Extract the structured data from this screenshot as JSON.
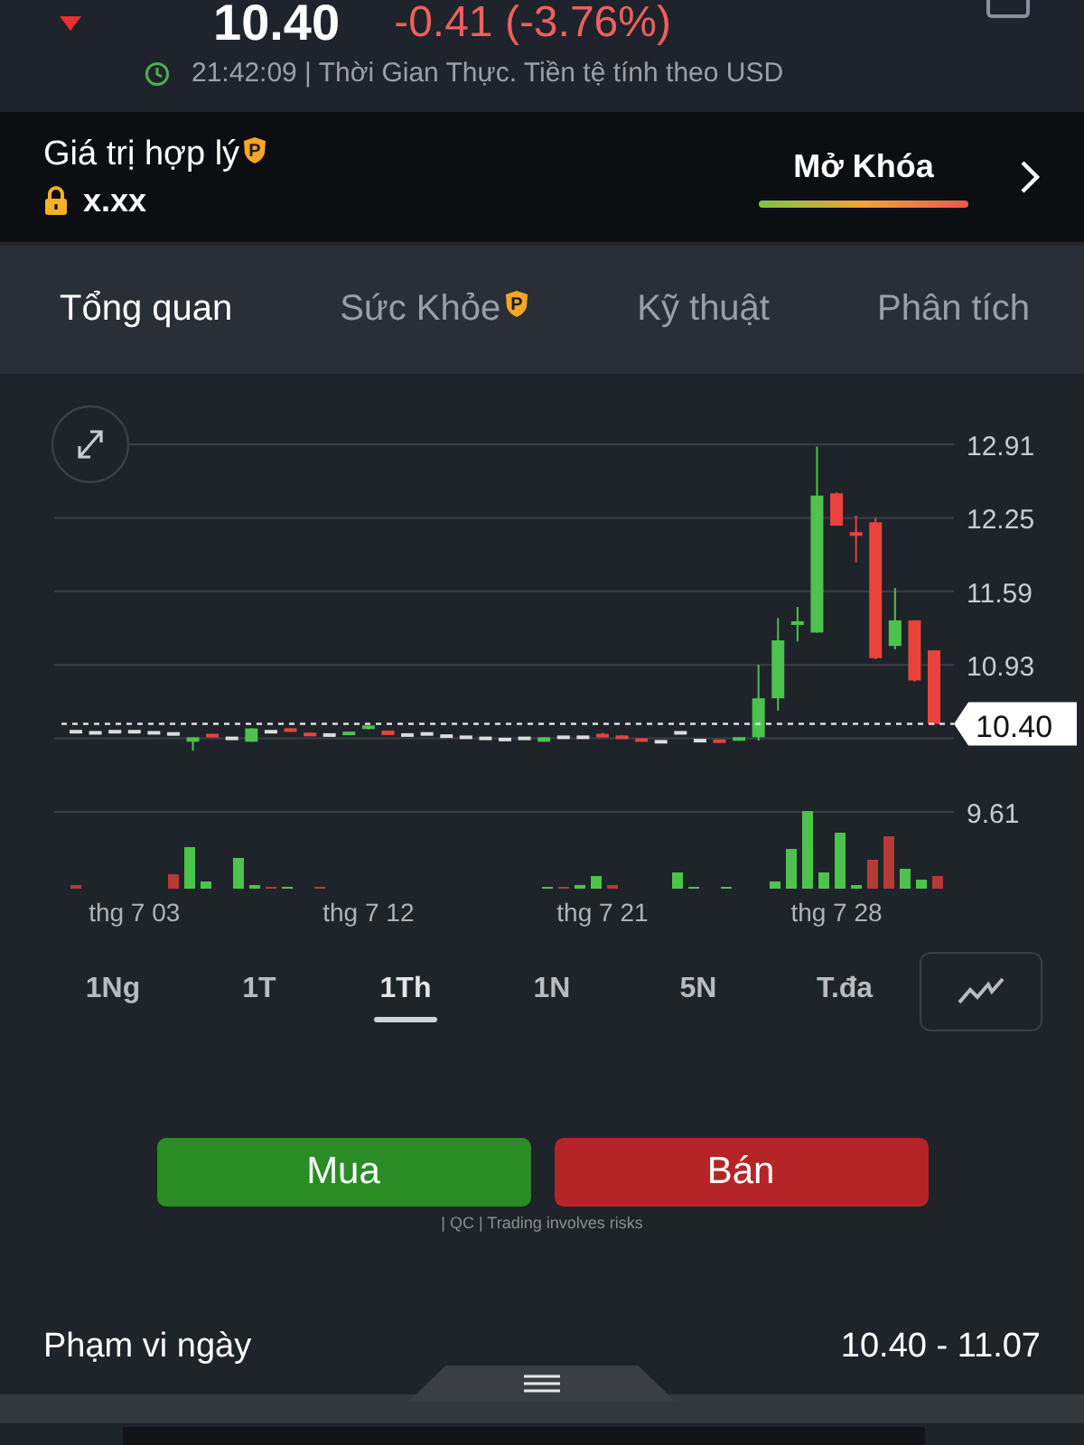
{
  "quote": {
    "price": "10.40",
    "change": "-0.41 (-3.76%)",
    "falling": true,
    "time_note": "21:42:09 | Thời Gian Thực. Tiền tệ tính theo USD"
  },
  "fair_value": {
    "label": "Giá trị hợp lý",
    "badge": "P",
    "value": "x.xx",
    "unlock": "Mở Khóa"
  },
  "tabs": [
    {
      "label": "Tổng quan",
      "selected": true
    },
    {
      "label": "Sức Khỏe",
      "selected": false,
      "badge": "P"
    },
    {
      "label": "Kỹ thuật",
      "selected": false
    },
    {
      "label": "Phân tích",
      "selected": false
    }
  ],
  "chart": {
    "chart_data": {
      "type": "candlestick",
      "grid": true,
      "categories": [
        null,
        null,
        null,
        "thg 7 03",
        null,
        null,
        null,
        null,
        null,
        null,
        null,
        null,
        null,
        null,
        null,
        "thg 7 12",
        null,
        null,
        null,
        null,
        null,
        null,
        null,
        null,
        null,
        null,
        null,
        "thg 7 21",
        null,
        null,
        null,
        null,
        null,
        null,
        null,
        null,
        null,
        null,
        null,
        "thg 7 28",
        null,
        null,
        null,
        null,
        null
      ],
      "ref_lines": [
        {
          "axis": "y",
          "value": 10.4,
          "label": "10.40"
        }
      ],
      "ohlc": [
        [
          10.33,
          10.34,
          10.32,
          10.33
        ],
        [
          10.32,
          10.33,
          10.31,
          10.32
        ],
        [
          10.33,
          10.34,
          10.32,
          10.33
        ],
        [
          10.33,
          10.34,
          10.32,
          10.33
        ],
        [
          10.32,
          10.33,
          10.31,
          10.32
        ],
        [
          10.31,
          10.32,
          10.3,
          10.31
        ],
        [
          10.24,
          10.28,
          10.16,
          10.28
        ],
        [
          10.31,
          10.31,
          10.28,
          10.28
        ],
        [
          10.27,
          10.27,
          10.26,
          10.27
        ],
        [
          10.24,
          10.36,
          10.24,
          10.36
        ],
        [
          10.33,
          10.34,
          10.32,
          10.33
        ],
        [
          10.35,
          10.36,
          10.33,
          10.34
        ],
        [
          10.32,
          10.32,
          10.29,
          10.29
        ],
        [
          10.3,
          10.31,
          10.3,
          10.3
        ],
        [
          10.3,
          10.33,
          10.3,
          10.33
        ],
        [
          10.36,
          10.38,
          10.35,
          10.38
        ],
        [
          10.34,
          10.34,
          10.3,
          10.3
        ],
        [
          10.3,
          10.31,
          10.3,
          10.3
        ],
        [
          10.31,
          10.32,
          10.31,
          10.31
        ],
        [
          10.29,
          10.3,
          10.29,
          10.29
        ],
        [
          10.28,
          10.28,
          10.28,
          10.28
        ],
        [
          10.27,
          10.28,
          10.27,
          10.27
        ],
        [
          10.26,
          10.27,
          10.26,
          10.26
        ],
        [
          10.27,
          10.28,
          10.27,
          10.27
        ],
        [
          10.24,
          10.28,
          10.24,
          10.28
        ],
        [
          10.28,
          10.29,
          10.27,
          10.28
        ],
        [
          10.28,
          10.29,
          10.28,
          10.28
        ],
        [
          10.31,
          10.32,
          10.28,
          10.28
        ],
        [
          10.29,
          10.3,
          10.27,
          10.27
        ],
        [
          10.26,
          10.26,
          10.25,
          10.25
        ],
        [
          10.24,
          10.24,
          10.24,
          10.24
        ],
        [
          10.32,
          10.32,
          10.32,
          10.32
        ],
        [
          10.25,
          10.26,
          10.25,
          10.25
        ],
        [
          10.25,
          10.25,
          10.24,
          10.24
        ],
        [
          10.25,
          10.28,
          10.25,
          10.28
        ],
        [
          10.28,
          10.93,
          10.25,
          10.63
        ],
        [
          10.63,
          11.35,
          10.52,
          11.15
        ],
        [
          11.3,
          11.45,
          11.14,
          11.31
        ],
        [
          11.22,
          12.89,
          11.22,
          12.45
        ],
        [
          12.47,
          12.48,
          12.18,
          12.18
        ],
        [
          12.12,
          12.27,
          11.85,
          12.09
        ],
        [
          12.21,
          12.25,
          10.98,
          10.99
        ],
        [
          11.1,
          11.62,
          11.07,
          11.33
        ],
        [
          11.33,
          11.33,
          10.78,
          10.79
        ],
        [
          11.06,
          11.06,
          10.39,
          10.4
        ]
      ],
      "ylim": [
        9.61,
        12.91
      ],
      "yticks": [
        12.91,
        12.25,
        11.59,
        10.93,
        9.61
      ]
    }
  },
  "ranges": [
    {
      "label": "1Ng",
      "selected": false
    },
    {
      "label": "1T",
      "selected": false
    },
    {
      "label": "1Th",
      "selected": true
    },
    {
      "label": "1N",
      "selected": false
    },
    {
      "label": "5N",
      "selected": false
    },
    {
      "label": "T.đa",
      "selected": false
    }
  ],
  "actions": {
    "buy": "Mua",
    "sell": "Bán",
    "disclaimer": "| QC | Trading involves risks"
  },
  "day_range": {
    "label": "Phạm vi ngày",
    "value": "10.40 - 11.07"
  }
}
